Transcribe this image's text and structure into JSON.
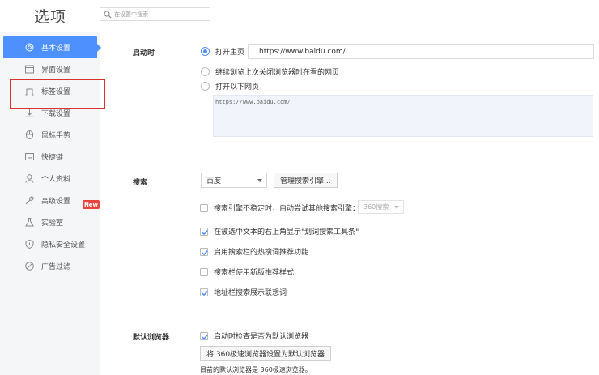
{
  "header": {
    "title": "选项",
    "search_placeholder": "在设置中搜索"
  },
  "sidebar": {
    "items": [
      {
        "label": "基本设置"
      },
      {
        "label": "界面设置"
      },
      {
        "label": "标签设置"
      },
      {
        "label": "下载设置"
      },
      {
        "label": "鼠标手势"
      },
      {
        "label": "快捷键"
      },
      {
        "label": "个人资料"
      },
      {
        "label": "高级设置"
      },
      {
        "label": "实验室"
      },
      {
        "label": "隐私安全设置"
      },
      {
        "label": "广告过滤"
      }
    ],
    "new_badge": "New"
  },
  "startup": {
    "label": "启动时",
    "open_home_label": "打开主页",
    "home_url": "https://www.baidu.com/",
    "continue_label": "继续浏览上次关闭浏览器时在看的网页",
    "open_pages_label": "打开以下网页",
    "pages_text": "https://www.baidu.com/"
  },
  "search": {
    "label": "搜索",
    "engine_selected": "百度",
    "manage_button": "管理搜索引擎...",
    "fallback_label": "搜索引擎不稳定时，自动尝试其他搜索引擎：",
    "fallback_engine": "360搜索",
    "show_toolbar_label": "在被选中文本的右上角显示\"划词搜索工具条\"",
    "hot_recommend_label": "启用搜索栏的热搜词推荐功能",
    "new_style_label": "搜索栏使用新版推荐样式",
    "address_suggest_label": "地址栏搜索展示联想词"
  },
  "default_browser": {
    "label": "默认浏览器",
    "check_label": "启动时检查是否为默认浏览器",
    "set_button": "将 360极速浏览器设置为默认浏览器",
    "status": "目前的默认浏览器是 360极速浏览器。"
  },
  "colors": {
    "accent": "#4d90fe",
    "badge": "#e9443d",
    "highlight": "#d9342b"
  }
}
